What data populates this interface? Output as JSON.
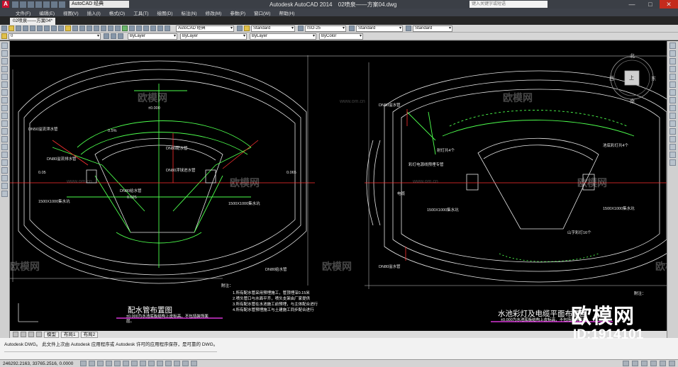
{
  "window": {
    "workspace": "AutoCAD 经典",
    "app_name": "Autodesk AutoCAD 2014",
    "file_name": "02喷泉——方案04.dwg",
    "search_placeholder": "键入关键字或短语",
    "buttons": {
      "minimize": "—",
      "maximize": "□",
      "close": "✕"
    }
  },
  "menu": [
    "文件(F)",
    "编辑(E)",
    "视图(V)",
    "插入(I)",
    "格式(O)",
    "工具(T)",
    "绘图(D)",
    "标注(N)",
    "修改(M)",
    "参数(P)",
    "窗口(W)",
    "帮助(H)"
  ],
  "doc_tabs": [
    {
      "label": "02喷泉——方案04*"
    }
  ],
  "toolbar": {
    "workspace_combo": "AutoCAD 经典",
    "text_style": "Standard",
    "dim_style": "ISO-25",
    "table_style": "Standard",
    "mleader_style": "Standard",
    "layer_value": "0",
    "color_value": "ByLayer",
    "linetype_value": "ByLayer",
    "lineweight_value": "ByLayer",
    "plotstyle_value": "ByColor"
  },
  "layout_tabs": [
    "模型",
    "布局1",
    "布局2"
  ],
  "command_line": {
    "history": "Autodesk DWG。  此文件上次由  Autodesk  应用程序或  Autodesk  许可的应用程序保存，是可靠的 DWG。"
  },
  "status": {
    "coords": "246292.2163, 33765.2516, 0.0000"
  },
  "compass": {
    "north": "北",
    "south": "南",
    "east": "东",
    "west": "西",
    "center": "上"
  },
  "drawing_left": {
    "title": "配水管布置图",
    "scale_note": "±0.000为水池底板结构上皮标高，不包括装饰面层。",
    "notes_title": "附注：",
    "notes": [
      "1.所有配水管采用预埋施工，管顶埋深0.15米",
      "2.喷头管口与水面平齐，喷头支架由厂家提供",
      "3.所有配水管在水池施工前预埋，与主体配合进行",
      "4.所有配水管预埋施工与土建施工同步配合进行"
    ],
    "labels": [
      "DN50溢流泄水管",
      "1500X1000集水坑",
      "DN80溢流排水管",
      "DN80浮球进水管",
      "DN80给水管",
      "DN80配水管",
      "0.5%",
      "0.025",
      "0.05",
      "0.065",
      "±0.000"
    ]
  },
  "drawing_right": {
    "title": "水池彩灯及电缆平面布置图",
    "scale_note": "±0.000为水池底板结构上皮标高，不包括装饰面层。",
    "notes_title": "附注：",
    "labels": [
      "DN80溢水管",
      "射灯共4个",
      "彩灯电源线预埋专管",
      "电缆",
      "1500X1000集水坑",
      "池底彩灯共4个",
      "1500X1000集水坑",
      "山字彩灯16个",
      "DN80溢水管"
    ]
  },
  "watermark": {
    "brand": "欧模网",
    "url": "www.om.cn",
    "id": "ID:1914101"
  }
}
